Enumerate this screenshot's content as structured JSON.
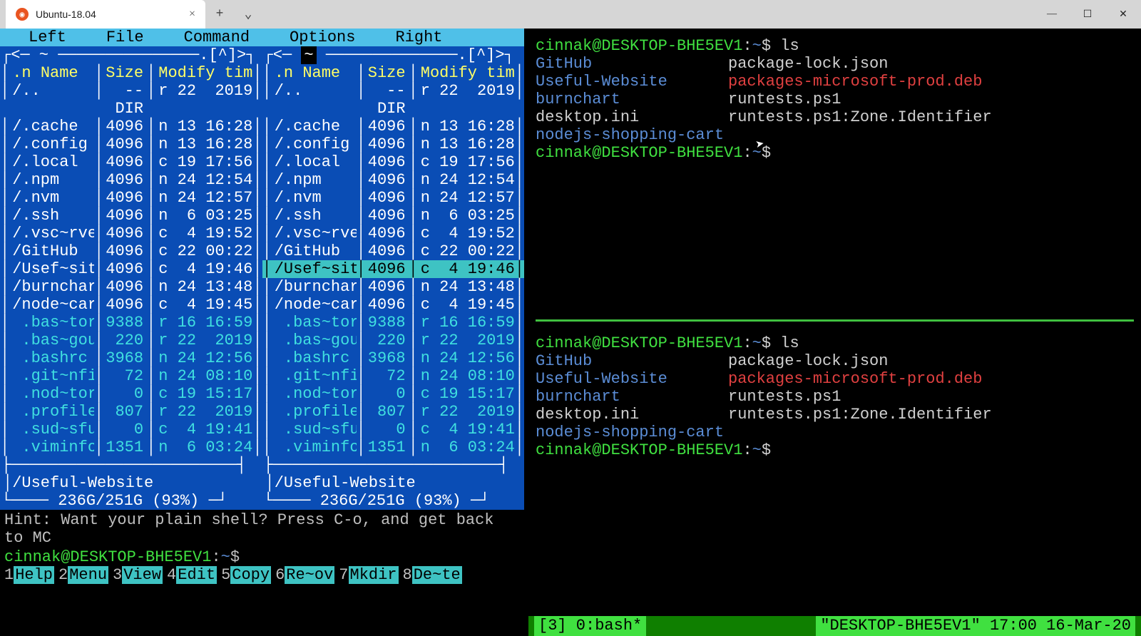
{
  "titlebar": {
    "tab_title": "Ubuntu-18.04",
    "close": "×",
    "plus": "+",
    "chevron": "⌄",
    "min": "—",
    "max": "☐",
    "x": "✕"
  },
  "mc": {
    "menu": [
      "Left",
      "File",
      "Command",
      "Options",
      "Right"
    ],
    "frame_left": "┌<─ ~ ───────────────.[^]>┐",
    "frame_right_inv": "~",
    "frame_right_suffix": " ──────────────.[^]>┐",
    "headers": {
      "n": ".n",
      "name": "Name",
      "size": "Size",
      "mtime": "Modify tim"
    },
    "rows": [
      {
        "name": "/..",
        "size": "--DIR",
        "time": "r 22  2019",
        "cyan": false
      },
      {
        "name": "/.cache",
        "size": "4096",
        "time": "n 13 16:28",
        "cyan": false
      },
      {
        "name": "/.config",
        "size": "4096",
        "time": "n 13 16:28",
        "cyan": false
      },
      {
        "name": "/.local",
        "size": "4096",
        "time": "c 19 17:56",
        "cyan": false
      },
      {
        "name": "/.npm",
        "size": "4096",
        "time": "n 24 12:54",
        "cyan": false
      },
      {
        "name": "/.nvm",
        "size": "4096",
        "time": "n 24 12:57",
        "cyan": false
      },
      {
        "name": "/.ssh",
        "size": "4096",
        "time": "n  6 03:25",
        "cyan": false
      },
      {
        "name": "/.vsc~rver",
        "size": "4096",
        "time": "c  4 19:52",
        "cyan": false
      },
      {
        "name": "/GitHub",
        "size": "4096",
        "time": "c 22 00:22",
        "cyan": false
      },
      {
        "name": "/Usef~site",
        "size": "4096",
        "time": "c  4 19:46",
        "cyan": false,
        "sel_right": true
      },
      {
        "name": "/burnchart",
        "size": "4096",
        "time": "n 24 13:48",
        "cyan": false
      },
      {
        "name": "/node~cart",
        "size": "4096",
        "time": "c  4 19:45",
        "cyan": false
      },
      {
        "name": " .bas~tory",
        "size": "9388",
        "time": "r 16 16:59",
        "cyan": true
      },
      {
        "name": " .bas~gout",
        "size": "220",
        "time": "r 22  2019",
        "cyan": true
      },
      {
        "name": " .bashrc",
        "size": "3968",
        "time": "n 24 12:56",
        "cyan": true
      },
      {
        "name": " .git~nfig",
        "size": "72",
        "time": "n 24 08:10",
        "cyan": true
      },
      {
        "name": " .nod~tory",
        "size": "0",
        "time": "c 19 15:17",
        "cyan": true
      },
      {
        "name": " .profile",
        "size": "807",
        "time": "r 22  2019",
        "cyan": true
      },
      {
        "name": " .sud~sful",
        "size": "0",
        "time": "c  4 19:41",
        "cyan": true
      },
      {
        "name": " .viminfo",
        "size": "1351",
        "time": "n  6 03:24",
        "cyan": true
      }
    ],
    "footer_path": "/Useful-Website",
    "disk": "236G/251G (93%)",
    "hint": "Hint: Want your plain shell? Press C-o, and get back to MC",
    "prompt_user": "cinnak@DESKTOP-BHE5EV1",
    "prompt_path": "~",
    "prompt_symbol": "$",
    "fkeys": [
      {
        "n": "1",
        "l": "Help"
      },
      {
        "n": "2",
        "l": "Menu"
      },
      {
        "n": "3",
        "l": "View"
      },
      {
        "n": "4",
        "l": "Edit"
      },
      {
        "n": "5",
        "l": "Copy"
      },
      {
        "n": "6",
        "l": "Re~ov"
      },
      {
        "n": "7",
        "l": "Mkdir"
      },
      {
        "n": "8",
        "l": "De~te"
      }
    ]
  },
  "term": {
    "prompt_user": "cinnak@DESKTOP-BHE5EV1",
    "prompt_path": "~",
    "prompt_symbol": "$",
    "cmd": "ls",
    "col1": [
      {
        "t": "GitHub",
        "c": "cyan"
      },
      {
        "t": "Useful-Website",
        "c": "cyan"
      },
      {
        "t": "burnchart",
        "c": "cyan"
      },
      {
        "t": "desktop.ini",
        "c": "w"
      },
      {
        "t": "nodejs-shopping-cart",
        "c": "cyan"
      }
    ],
    "col2": [
      {
        "t": "package-lock.json",
        "c": "w"
      },
      {
        "t": "packages-microsoft-prod.deb",
        "c": "red"
      },
      {
        "t": "runtests.ps1",
        "c": "w"
      },
      {
        "t": "runtests.ps1:Zone.Identifier",
        "c": "w"
      }
    ]
  },
  "tmux": {
    "left": "[3] 0:bash*",
    "right": "\"DESKTOP-BHE5EV1\" 17:00 16-Mar-20"
  }
}
